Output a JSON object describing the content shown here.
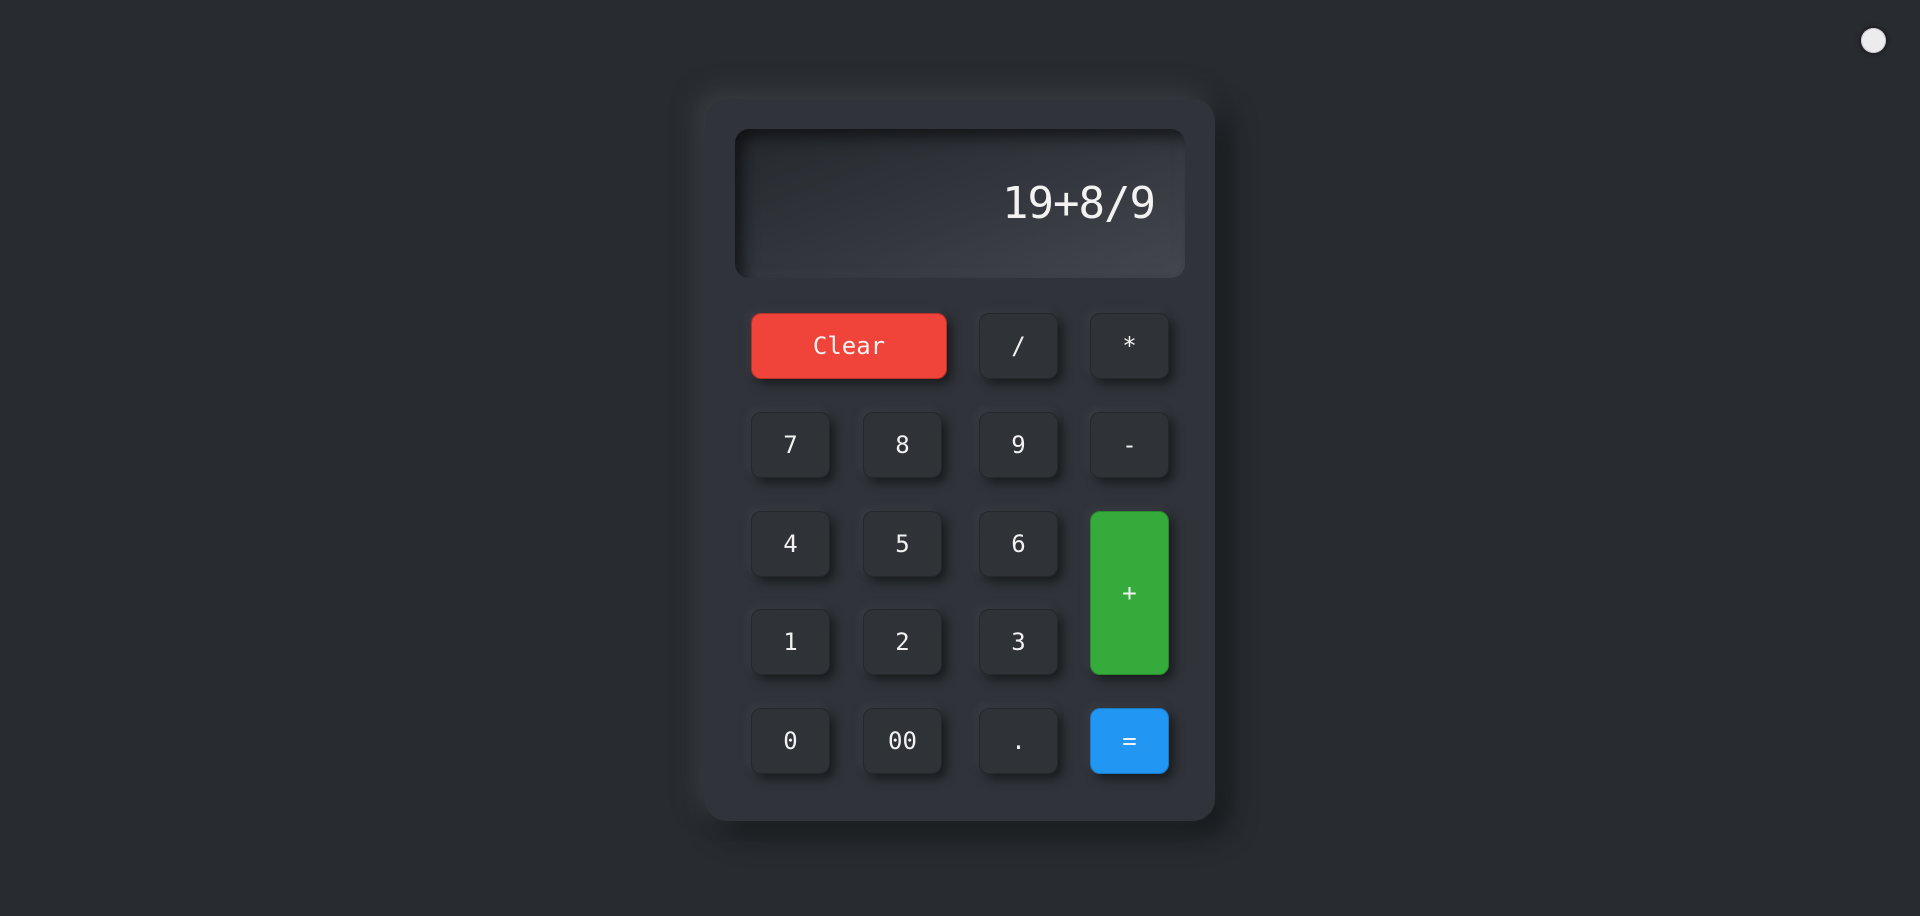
{
  "theme_toggle": {
    "label": ""
  },
  "display": {
    "value": "19+8/9"
  },
  "keys": {
    "clear": "Clear",
    "divide": "/",
    "multiply": "*",
    "seven": "7",
    "eight": "8",
    "nine": "9",
    "minus": "-",
    "four": "4",
    "five": "5",
    "six": "6",
    "plus": "+",
    "one": "1",
    "two": "2",
    "three": "3",
    "zero": "0",
    "double_zero": "00",
    "decimal": ".",
    "equals": "="
  },
  "colors": {
    "background": "#282b2f",
    "body": "#30343a",
    "clear": "#f04339",
    "plus": "#34ab3a",
    "equals": "#2196f3"
  }
}
